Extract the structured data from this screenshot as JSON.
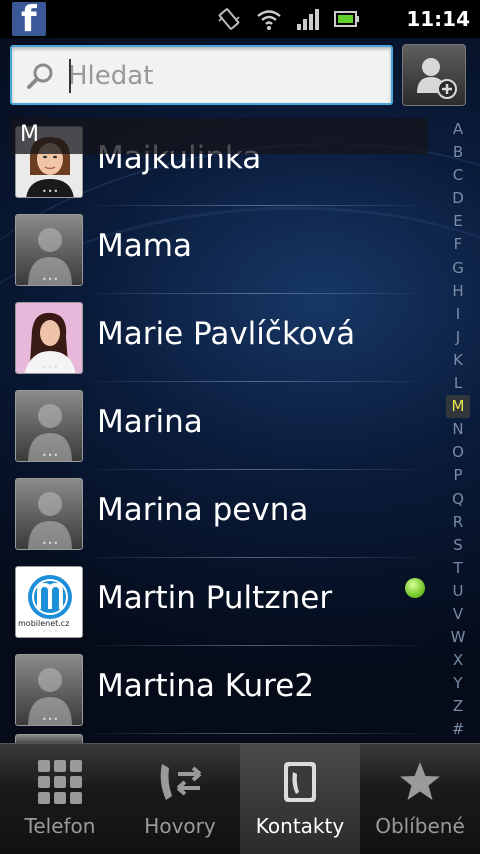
{
  "status_bar": {
    "time": "11:14",
    "notification_icon": "facebook-icon",
    "icons": [
      "vibrate-icon",
      "wifi-icon",
      "signal-icon",
      "battery-icon"
    ]
  },
  "search": {
    "placeholder": "Hledat",
    "value": ""
  },
  "contacts": {
    "section_letter": "M",
    "items": [
      {
        "name": "Majkulinka",
        "avatar": "photo-woman",
        "online": false
      },
      {
        "name": "Mama",
        "avatar": "default-person",
        "online": false
      },
      {
        "name": "Marie Pavlíčková",
        "avatar": "photo-woman-pink",
        "online": false
      },
      {
        "name": "Marina",
        "avatar": "default-person",
        "online": false
      },
      {
        "name": "Marina pevna",
        "avatar": "default-person",
        "online": false
      },
      {
        "name": "Martin Pultzner",
        "avatar": "mobilenet-logo",
        "avatar_caption": "mobilenet.cz",
        "online": true
      },
      {
        "name": "Martina Kure2",
        "avatar": "default-person",
        "online": false
      }
    ]
  },
  "index_letters": [
    "A",
    "B",
    "C",
    "D",
    "E",
    "F",
    "G",
    "H",
    "I",
    "J",
    "K",
    "L",
    "M",
    "N",
    "O",
    "P",
    "Q",
    "R",
    "S",
    "T",
    "U",
    "V",
    "W",
    "X",
    "Y",
    "Z",
    "#"
  ],
  "index_active": "M",
  "tabs": [
    {
      "label": "Telefon",
      "icon": "dialpad-icon",
      "active": false
    },
    {
      "label": "Hovory",
      "icon": "call-log-icon",
      "active": false
    },
    {
      "label": "Kontakty",
      "icon": "contacts-icon",
      "active": true
    },
    {
      "label": "Oblíbené",
      "icon": "star-icon",
      "active": false
    }
  ],
  "colors": {
    "search_border": "#4aa6d9",
    "index_active": "#e8e84a",
    "presence_online": "#76c72a"
  }
}
